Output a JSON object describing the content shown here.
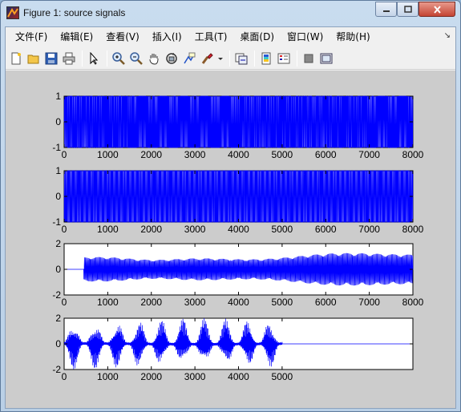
{
  "window": {
    "title": "Figure 1: source signals"
  },
  "menu": [
    "文件(F)",
    "编辑(E)",
    "查看(V)",
    "插入(I)",
    "工具(T)",
    "桌面(D)",
    "窗口(W)",
    "帮助(H)"
  ],
  "toolbar_icons": [
    "new-figure-icon",
    "open-file-icon",
    "save-icon",
    "print-icon",
    "select-arrow-icon",
    "zoom-in-icon",
    "zoom-out-icon",
    "pan-hand-icon",
    "rotate-3d-icon",
    "data-cursor-icon",
    "brush-icon",
    "link-plot-icon",
    "colorbar-icon",
    "legend-icon",
    "hide-plot-tools-icon",
    "show-plot-tools-icon"
  ],
  "colors": {
    "signal": "#0000ff",
    "figure_bg": "#cccccc",
    "axes_bg": "#ffffff"
  },
  "chart_data": [
    {
      "type": "line",
      "x_ticks": [
        "0",
        "1000",
        "2000",
        "3000",
        "4000",
        "5000",
        "6000",
        "7000",
        "8000"
      ],
      "y_ticks": [
        "1",
        "0",
        "-1"
      ],
      "xlim": [
        0,
        8000
      ],
      "ylim": [
        -1,
        1
      ],
      "series": [
        {
          "description": "dense square-like oscillation spanning full range"
        }
      ]
    },
    {
      "type": "line",
      "x_ticks": [
        "0",
        "1000",
        "2000",
        "3000",
        "4000",
        "5000",
        "6000",
        "7000",
        "8000"
      ],
      "y_ticks": [
        "1",
        "0",
        "-1"
      ],
      "xlim": [
        0,
        8000
      ],
      "ylim": [
        -1,
        1
      ],
      "series": [
        {
          "description": "periodic dense bursts, full amplitude"
        }
      ]
    },
    {
      "type": "line",
      "x_ticks": [
        "0",
        "1000",
        "2000",
        "3000",
        "4000",
        "5000",
        "6000",
        "7000",
        "8000"
      ],
      "y_ticks": [
        "2",
        "0",
        "-2"
      ],
      "xlim": [
        0,
        8000
      ],
      "ylim": [
        -2,
        2
      ],
      "series": [
        {
          "description": "flat until ~450, then modulated oscillation; envelope peaks ~6100 near 1.7"
        }
      ]
    },
    {
      "type": "line",
      "x_ticks": [
        "0",
        "1000",
        "2000",
        "3000",
        "4000",
        "5000"
      ],
      "y_ticks": [
        "2",
        "0",
        "-2"
      ],
      "xlim": [
        0,
        8000
      ],
      "ylim": [
        -2,
        2
      ],
      "series": [
        {
          "description": "10 speech-like bursts from 0 to ~5000, flat afterwards"
        }
      ]
    }
  ]
}
